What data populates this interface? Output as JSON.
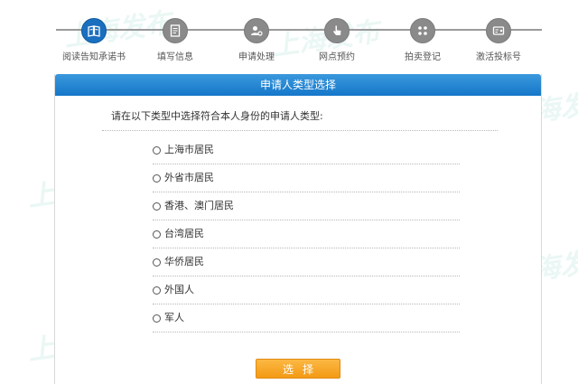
{
  "stepper": {
    "steps": [
      {
        "label": "阅读告知承诺书",
        "icon": "book-icon",
        "active": true
      },
      {
        "label": "填写信息",
        "icon": "form-icon",
        "active": false
      },
      {
        "label": "申请处理",
        "icon": "user-gear-icon",
        "active": false
      },
      {
        "label": "网点预约",
        "icon": "hand-pointer-icon",
        "active": false
      },
      {
        "label": "拍卖登记",
        "icon": "auction-icon",
        "active": false
      },
      {
        "label": "激活投标号",
        "icon": "card-icon",
        "active": false
      }
    ]
  },
  "panel": {
    "title": "申请人类型选择",
    "instruction": "请在以下类型中选择符合本人身份的申请人类型:",
    "options": [
      "上海市居民",
      "外省市居民",
      "香港、澳门居民",
      "台湾居民",
      "华侨居民",
      "外国人",
      "军人"
    ],
    "select_button_label": "选择"
  },
  "watermark": {
    "text": "上海发布"
  },
  "colors": {
    "header_blue": "#1577c9",
    "active_step": "#1a6fbf",
    "inactive_step": "#8a8a8a",
    "button_orange": "#f39a14"
  }
}
